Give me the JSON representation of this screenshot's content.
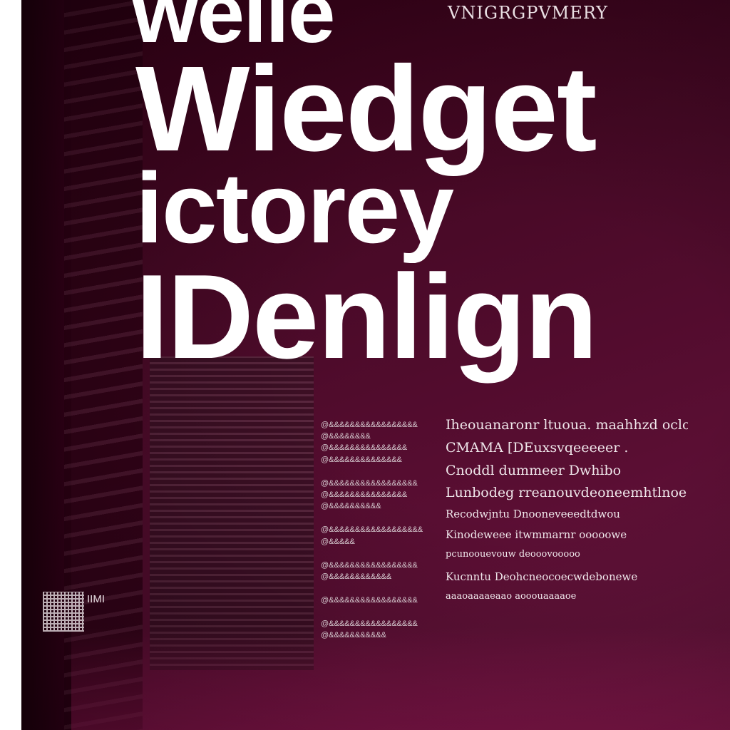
{
  "poster": {
    "headline": [
      "welle",
      "Wiedget",
      "ictorey",
      "IDenlign"
    ],
    "tagline": "VNIGRGPVMERY",
    "left_column": [
      "@&&&&&&&&&&&&&&&&&",
      "@&&&&&&&&",
      "@&&&&&&&&&&&&&&&",
      "@&&&&&&&&&&&&&&",
      "",
      "@&&&&&&&&&&&&&&&&&",
      "@&&&&&&&&&&&&&&&",
      "@&&&&&&&&&&",
      "",
      "@&&&&&&&&&&&&&&&&&&",
      "@&&&&&",
      "",
      "@&&&&&&&&&&&&&&&&&",
      "@&&&&&&&&&&&&",
      "",
      "@&&&&&&&&&&&&&&&&&",
      "",
      "@&&&&&&&&&&&&&&&&&",
      "@&&&&&&&&&&&"
    ],
    "right_column": [
      "Iheouanaronr ltuoua. maahhzd oclol",
      "CMAMA [DEuxsvqeeeeer .",
      "Cnoddl dummeer Dwhibo",
      "Lunbodeg rreanouvdeoneemhtlnoe",
      "Recodwjntu Dnooneveeedtdwou",
      "Kinodeweee itwmmarnr ooooowe",
      "pcunoouevouw deooovooooo",
      "Kucnntu Deohcneocoecwdebonewe",
      "aaaoaaaaeaao aooouaaaaoe"
    ],
    "qr_label": "IIMI"
  }
}
